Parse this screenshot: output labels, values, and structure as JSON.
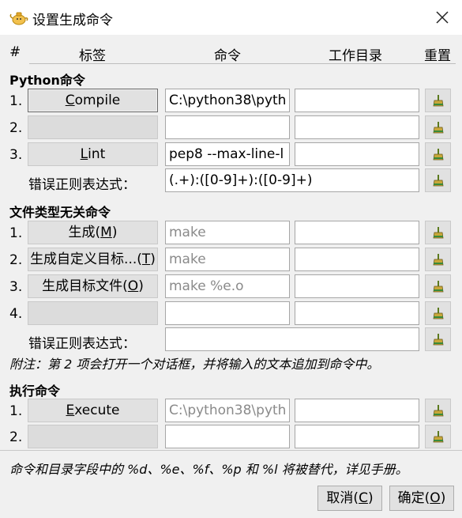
{
  "window": {
    "title": "设置生成命令",
    "close_label": "✕"
  },
  "headers": {
    "num": "#",
    "label": "标签",
    "command": "命令",
    "workdir": "工作目录",
    "reset": "重置"
  },
  "python_section": {
    "title": "Python命令",
    "rows": [
      {
        "num": "1.",
        "label_pre": "",
        "label_key": "C",
        "label_post": "ompile",
        "command": "C:\\python38\\pyth",
        "dir": ""
      },
      {
        "num": "2.",
        "label_pre": "",
        "label_key": "",
        "label_post": "",
        "command": "",
        "dir": ""
      },
      {
        "num": "3.",
        "label_pre": "",
        "label_key": "L",
        "label_post": "int",
        "command": "pep8 --max-line-l",
        "dir": ""
      }
    ],
    "error_regex_label": "错误正则表达式：",
    "error_regex": "(.+):([0-9]+):([0-9]+)"
  },
  "independent_section": {
    "title": "文件类型无关命令",
    "rows": [
      {
        "num": "1.",
        "label_pre": "生成(",
        "label_key": "M",
        "label_post": ")",
        "command": "make",
        "dir": ""
      },
      {
        "num": "2.",
        "label_pre": "生成自定义目标...(",
        "label_key": "T",
        "label_post": ")",
        "command": "make",
        "dir": ""
      },
      {
        "num": "3.",
        "label_pre": "生成目标文件(",
        "label_key": "O",
        "label_post": ")",
        "command": "make %e.o",
        "dir": ""
      },
      {
        "num": "4.",
        "label_pre": "",
        "label_key": "",
        "label_post": "",
        "command": "",
        "dir": ""
      }
    ],
    "error_regex_label": "错误正则表达式：",
    "error_regex": "",
    "note": "附注：第 2 项会打开一个对话框，并将输入的文本追加到命令中。"
  },
  "execute_section": {
    "title": "执行命令",
    "rows": [
      {
        "num": "1.",
        "label_pre": "",
        "label_key": "E",
        "label_post": "xecute",
        "command": "C:\\python38\\pyth",
        "dir": ""
      },
      {
        "num": "2.",
        "label_pre": "",
        "label_key": "",
        "label_post": "",
        "command": "",
        "dir": ""
      }
    ]
  },
  "footer_note": "命令和目录字段中的 %d、%e、%f、%p 和 %l 将被替代，详见手册。",
  "buttons": {
    "cancel_pre": "取消(",
    "cancel_key": "C",
    "cancel_post": ")",
    "ok_pre": "确定(",
    "ok_key": "O",
    "ok_post": ")"
  },
  "icons": {
    "app": "geany-teapot-icon",
    "reset": "broom-icon",
    "close": "close-icon"
  }
}
